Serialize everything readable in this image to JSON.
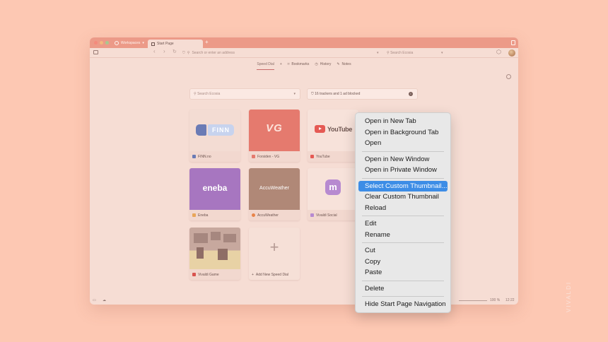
{
  "colors": {
    "background": "#fdc8b3",
    "accent": "#ec9a88",
    "selection": "#3d8de6"
  },
  "tabbar": {
    "workspaces_label": "Workspaces",
    "active_tab": "Start Page",
    "new_tab_symbol": "+"
  },
  "address": {
    "placeholder": "Search or enter an address",
    "search_placeholder": "Search Ecosia"
  },
  "speedbar": {
    "speed_dial": "Speed Dial",
    "add": "+",
    "bookmarks": "Bookmarks",
    "history": "History",
    "notes": "Notes"
  },
  "search_box": {
    "placeholder": "Search Ecosia"
  },
  "tracker": {
    "text": "16 trackers and 1 ad blocked"
  },
  "dials": [
    {
      "title": "FINN.no",
      "logo": "FINN"
    },
    {
      "title": "Forsiden - VG",
      "logo": "VG"
    },
    {
      "title": "YouTube",
      "logo": "YouTube"
    },
    {
      "title": "Eneba",
      "logo": "eneba"
    },
    {
      "title": "AccuWeather",
      "logo": "AccuWeather"
    },
    {
      "title": "Vivaldi Social",
      "logo": "m"
    },
    {
      "title": "Vivaldi Game",
      "logo": ""
    },
    {
      "title": "Add New Speed Dial",
      "logo": "+"
    }
  ],
  "statusbar": {
    "zoom": "100 %",
    "time": "12:22"
  },
  "context_menu": [
    "Open in New Tab",
    "Open in Background Tab",
    "Open",
    "Open in New Window",
    "Open in Private Window",
    "Select Custom Thumbnail...",
    "Clear Custom Thumbnail",
    "Reload",
    "Edit",
    "Rename",
    "Cut",
    "Copy",
    "Paste",
    "Delete",
    "Hide Start Page Navigation"
  ],
  "brand": "VIVALDI"
}
